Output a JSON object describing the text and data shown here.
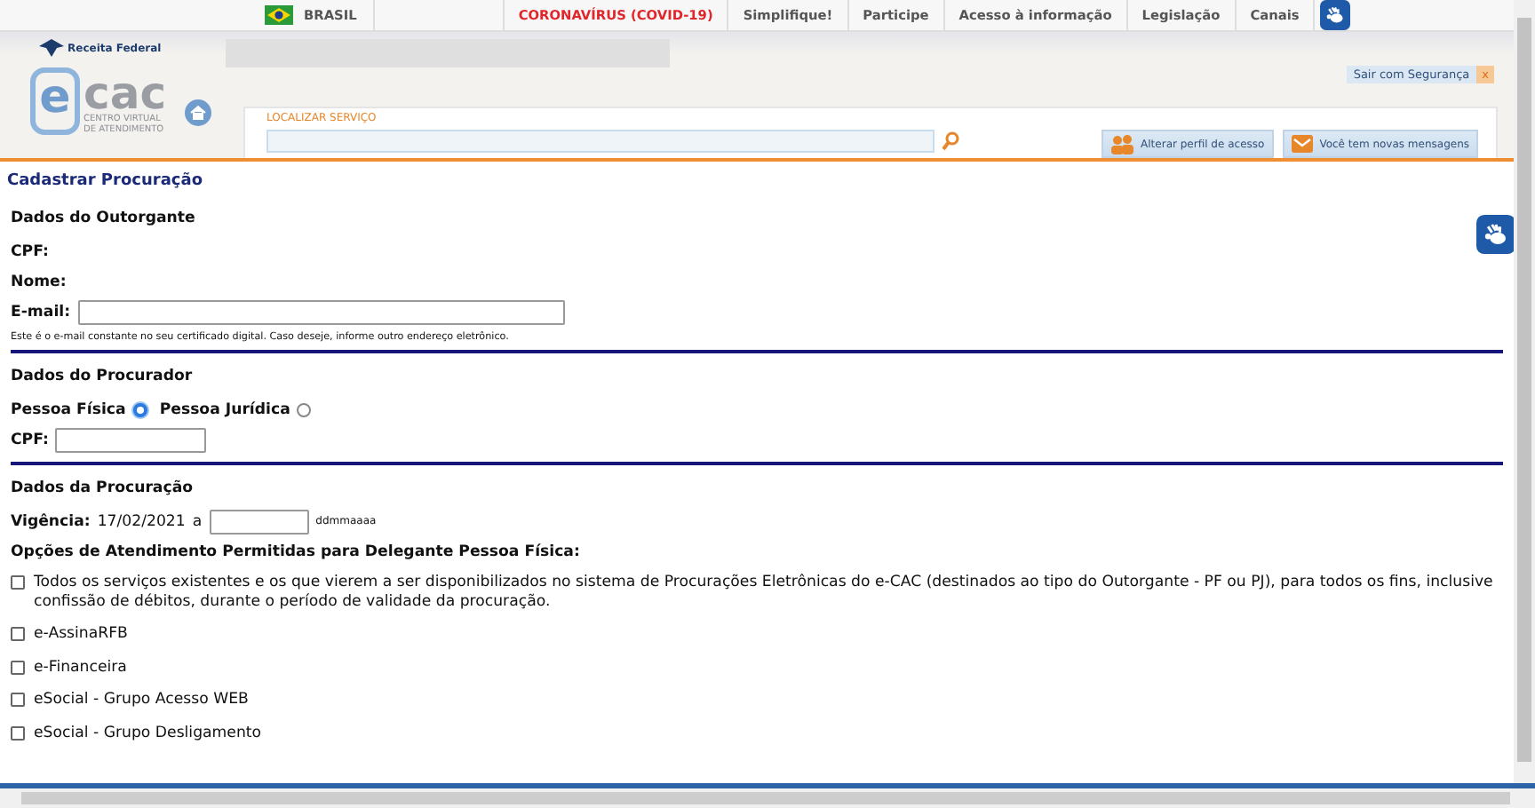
{
  "gov_bar": {
    "country": "BRASIL",
    "links": [
      {
        "label": "CORONAVÍRUS (COVID-19)",
        "kind": "alert"
      },
      {
        "label": "Simplifique!",
        "kind": "normal"
      },
      {
        "label": "Participe",
        "kind": "normal"
      },
      {
        "label": "Acesso à informação",
        "kind": "normal"
      },
      {
        "label": "Legislação",
        "kind": "normal"
      },
      {
        "label": "Canais",
        "kind": "normal"
      }
    ]
  },
  "header": {
    "brand": "Receita Federal",
    "logo": {
      "letter": "e",
      "word": "cac",
      "subtitle_lines": [
        "CENTRO VIRTUAL",
        "DE ATENDIMENTO"
      ]
    },
    "logout": "Sair com Segurança",
    "logout_close": "x",
    "search": {
      "label": "LOCALIZAR SERVIÇO"
    },
    "buttons": [
      {
        "label": "Alterar perfil de acesso",
        "kind": "profile"
      },
      {
        "label": "Você tem novas mensagens",
        "kind": "mail"
      }
    ]
  },
  "page_title": "Cadastrar Procuração",
  "outorgante": {
    "heading": "Dados do Outorgante",
    "cpf_label": "CPF:",
    "name_label": "Nome:",
    "email_label": "E-mail:",
    "email_hint": "Este é o e-mail constante no seu certificado digital. Caso deseje, informe outro endereço eletrônico."
  },
  "procurador": {
    "heading": "Dados do Procurador",
    "person_types": [
      {
        "label": "Pessoa Física",
        "selected": true
      },
      {
        "label": "Pessoa Jurídica",
        "selected": false
      }
    ],
    "cpf_label": "CPF:"
  },
  "procuracao": {
    "heading": "Dados da Procuração",
    "validity_label": "Vigência:",
    "start_date": "17/02/2021",
    "separator": "a",
    "date_format": "ddmmaaaa",
    "options_heading": "Opções de Atendimento Permitidas para Delegante Pessoa Física:",
    "options": [
      {
        "label": "Todos os serviços existentes e os que vierem a ser disponibilizados no sistema de Procurações Eletrônicas do e-CAC (destinados ao tipo do Outorgante - PF ou PJ), para todos os fins, inclusive confissão de débitos, durante o período de validade da procuração.",
        "checked": false
      },
      {
        "label": "e-AssinaRFB",
        "checked": false
      },
      {
        "label": "e-Financeira",
        "checked": false
      },
      {
        "label": "eSocial - Grupo Acesso WEB",
        "checked": false
      },
      {
        "label": "eSocial - Grupo Desligamento",
        "checked": false
      }
    ]
  }
}
